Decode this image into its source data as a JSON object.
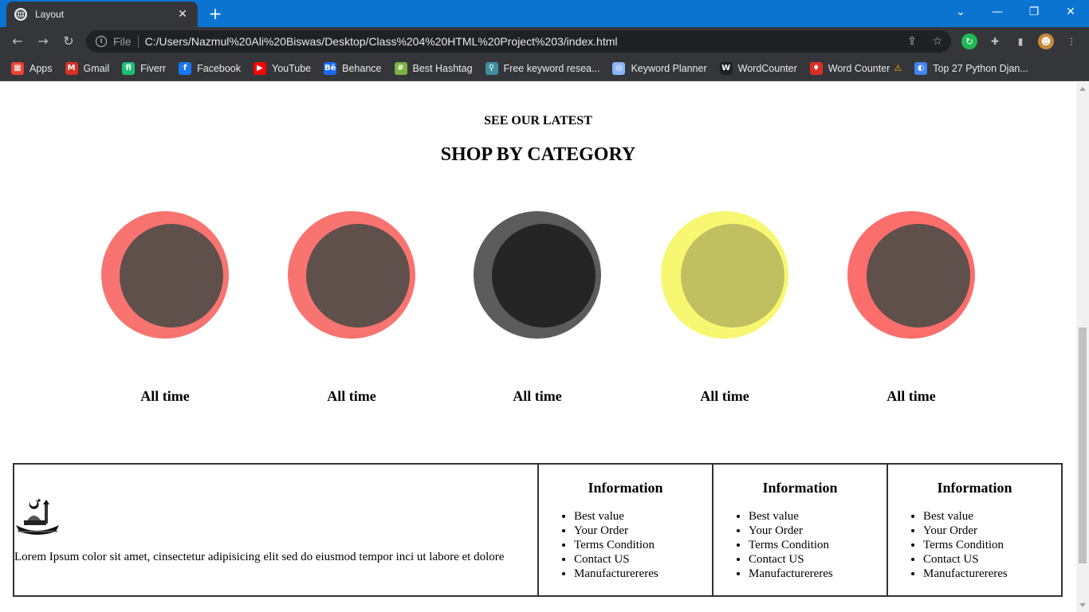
{
  "browser": {
    "tab_title": "Layout",
    "url_scheme": "File",
    "url": "C:/Users/Nazmul%20Ali%20Biswas/Desktop/Class%204%20HTML%20Project%203/index.html",
    "bookmarks": [
      {
        "label": "Apps",
        "icon": "apps-grid-icon",
        "color": "#ea4335"
      },
      {
        "label": "Gmail",
        "icon": "gmail-icon",
        "color": "#d93025"
      },
      {
        "label": "Fiverr",
        "icon": "fiverr-icon",
        "color": "#1dbf73"
      },
      {
        "label": "Facebook",
        "icon": "facebook-icon",
        "color": "#1877f2"
      },
      {
        "label": "YouTube",
        "icon": "youtube-icon",
        "color": "#ff0000"
      },
      {
        "label": "Behance",
        "icon": "behance-icon",
        "color": "#1769ff"
      },
      {
        "label": "Best Hashtag",
        "icon": "hashtag-icon",
        "color": "#7cb342"
      },
      {
        "label": "Free keyword resea...",
        "icon": "keyword-search-icon",
        "color": "#3e8e9f"
      },
      {
        "label": "Keyword Planner",
        "icon": "keyword-planner-icon",
        "color": "#8ab4f8"
      },
      {
        "label": "WordCounter",
        "icon": "wordcounter-w-icon",
        "color": "#202124"
      },
      {
        "label": "Word Counter",
        "icon": "word-counter-flame-icon",
        "color": "#d93025"
      },
      {
        "label": "Top 27 Python Djan...",
        "icon": "python-django-icon",
        "color": "#4285f4"
      }
    ]
  },
  "page": {
    "eyebrow": "SEE OUR LATEST",
    "heading": "SHOP BY CATEGORY",
    "categories": [
      {
        "label": "All time",
        "ring_color": "#f87470",
        "inner_color": "#5f504b"
      },
      {
        "label": "All time",
        "ring_color": "#f87470",
        "inner_color": "#5f504b"
      },
      {
        "label": "All time",
        "ring_color": "#5c5c5c",
        "inner_color": "#252525"
      },
      {
        "label": "All time",
        "ring_color": "#f7f772",
        "inner_color": "#c0c060"
      },
      {
        "label": "All time",
        "ring_color": "#fb6e6c",
        "inner_color": "#5f504b"
      }
    ]
  },
  "footer": {
    "brand_text": "Lorem Ipsum color sit amet, cinsectetur adipisicing elit sed do eiusmod tempor inci ut labore et dolore",
    "columns": [
      {
        "title": "Information",
        "items": [
          "Best value",
          "Your Order",
          "Terms Condition",
          "Contact US",
          "Manufacturereres"
        ]
      },
      {
        "title": "Information",
        "items": [
          "Best value",
          "Your Order",
          "Terms Condition",
          "Contact US",
          "Manufacturereres"
        ]
      },
      {
        "title": "Information",
        "items": [
          "Best value",
          "Your Order",
          "Terms Condition",
          "Contact US",
          "Manufacturereres"
        ]
      }
    ]
  }
}
